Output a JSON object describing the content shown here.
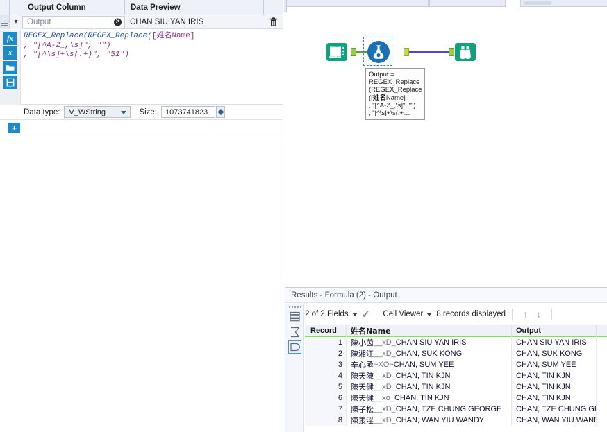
{
  "config_panel": {
    "columns": {
      "output_column": "Output Column",
      "data_preview": "Data Preview"
    },
    "row": {
      "output_name_value": "Output",
      "output_name_placeholder": "Output",
      "data_preview_value": "CHAN SIU YAN IRIS",
      "clear_icon": "clear-circle-icon",
      "delete_icon": "trash-icon",
      "grip_icon": "drag-grip-icon",
      "expand_icon": "chevron-down-icon"
    },
    "editor_tools": [
      {
        "name": "fx-function-icon",
        "label": "fx"
      },
      {
        "name": "variables-icon",
        "label": "X"
      },
      {
        "name": "open-folder-icon",
        "label": ""
      },
      {
        "name": "save-icon",
        "label": ""
      }
    ],
    "formula": {
      "line1_fn": "REGEX_Replace(REGEX_Replace(",
      "line1_field": "[姓名Name]",
      "line2": ", \"[^A-Z_,\\s]\", \"\")",
      "line3": ", \"[^\\s]+\\s(.+)\", \"$1\")",
      "full": "REGEX_Replace(REGEX_Replace([姓名Name]\n, \"[^A-Z_,\\s]\", \"\")\n, \"[^\\s]+\\s(.+)\", \"$1\")"
    },
    "data_type_label": "Data type:",
    "data_type_value": "V_WString",
    "size_label": "Size:",
    "size_value": "1073741823",
    "add_button_label": "+"
  },
  "canvas": {
    "nodes": [
      {
        "name": "input-data-tool",
        "icon": "book-icon",
        "color": "#0f9f7a"
      },
      {
        "name": "formula-tool",
        "icon": "flask-icon",
        "color": "#1a6fb5",
        "selected": true
      },
      {
        "name": "browse-tool",
        "icon": "binoculars-icon",
        "color": "#0f9f7a"
      }
    ],
    "annotation": {
      "line1": "Output =",
      "line2": "REGEX_Replace",
      "line3": "(REGEX_Replace",
      "line4_prefix": "([",
      "line4_cjk": "姓名",
      "line4_suffix": "Name]",
      "line5": ", \"[^A-Z_,\\s]\", \"\")",
      "line6": ", \"[^\\s]+\\s(.+…"
    },
    "connection_colors": {
      "input_to_formula": "#52a832",
      "formula_to_browse": "#5b3fd4"
    }
  },
  "results": {
    "title": "Results - Formula (2) - Output",
    "toolbar": {
      "fields_label": "2 of 2 Fields",
      "fields_caret": "chevron-down-icon",
      "check_icon": "checkmark-icon",
      "cell_viewer_label": "Cell Viewer",
      "cell_viewer_caret": "chevron-down-icon",
      "records_label": "8 records displayed",
      "up_arrow": "arrow-up-icon",
      "down_arrow": "arrow-down-icon"
    },
    "side_tools": [
      {
        "name": "table-list-icon"
      },
      {
        "name": "sigma-icon"
      },
      {
        "name": "field-shape-icon",
        "selected": true
      }
    ],
    "grid": {
      "headers": [
        "Record",
        "姓名Name",
        "Output"
      ],
      "rows": [
        {
          "record": "1",
          "name_cjk": "陳小茵",
          "name_sep": "__xD_ ",
          "name_rest": "CHAN SIU YAN IRIS",
          "output": "CHAN SIU YAN IRIS"
        },
        {
          "record": "2",
          "name_cjk": "陳湘江",
          "name_sep": "__xD_ ",
          "name_rest": "CHAN, SUK KONG",
          "output": "CHAN, SUK KONG"
        },
        {
          "record": "3",
          "name_cjk": "辛心亟",
          "name_sep": " ~XO~ ",
          "name_rest": "CHAN, SUM YEE",
          "output": "CHAN, SUM YEE"
        },
        {
          "record": "4",
          "name_cjk": "陳天陳",
          "name_sep": "__xD_ ",
          "name_rest": "CHAN, TIN KJN",
          "output": "CHAN, TIN KJN"
        },
        {
          "record": "5",
          "name_cjk": "陳天健",
          "name_sep": "__xD_ ",
          "name_rest": "CHAN, TIN KJN",
          "output": "CHAN, TIN KJN"
        },
        {
          "record": "6",
          "name_cjk": "陳天健",
          "name_sep": "__xo_ ",
          "name_rest": "CHAN, TIN KJN",
          "output": "CHAN, TIN KJN"
        },
        {
          "record": "7",
          "name_cjk": "陳子松",
          "name_sep": "__xD_ ",
          "name_rest": "CHAN, TZE CHUNG GEORGE",
          "output": "CHAN, TZE CHUNG GEORGE"
        },
        {
          "record": "8",
          "name_cjk": "陳羕淫",
          "name_sep": "__xD_ ",
          "name_rest": "CHAN, WAN YIU WANDY",
          "output": "CHAN, WAN YIU WANDY"
        }
      ]
    }
  },
  "theme": {
    "accent_blue": "#1a8ccc",
    "header_bg": "#eef1f8",
    "grid_header_underline": "#8fd66b",
    "tool_green": "#0f9f7a",
    "tool_blue": "#1a6fb5"
  }
}
